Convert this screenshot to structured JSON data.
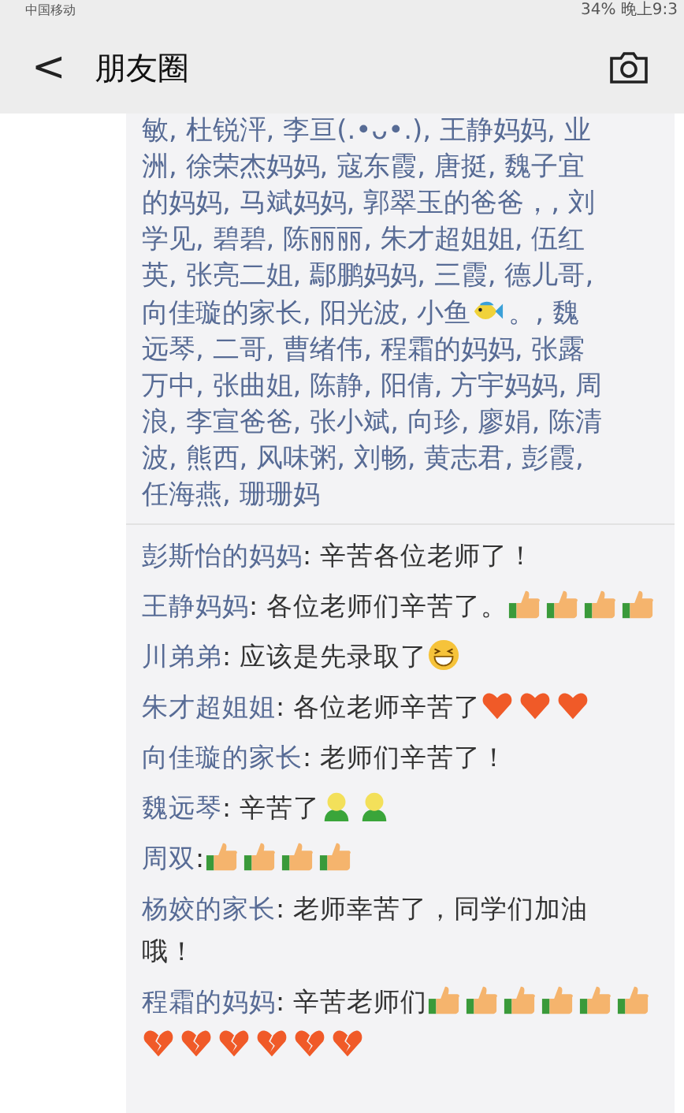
{
  "status_bar": {
    "carrier": "中国移动",
    "battery": "34%",
    "time": "晚上9:3"
  },
  "header": {
    "back": "<",
    "title": "朋友圈"
  },
  "likes": {
    "lines": [
      [
        {
          "kind": "text",
          "text": "敏, 杜锐泙, 李亘(.•ᴗ•.), 王静妈妈, 业"
        }
      ],
      [
        {
          "kind": "text",
          "text": "洲, 徐荣杰妈妈, 寇东霞, 唐挺, 魏子宜"
        }
      ],
      [
        {
          "kind": "text",
          "text": "的妈妈, 马斌妈妈, 郭翠玉的爸爸，, 刘"
        }
      ],
      [
        {
          "kind": "text",
          "text": "学见, 碧碧, 陈丽丽, 朱才超姐姐, 伍红"
        }
      ],
      [
        {
          "kind": "text",
          "text": "英, 张亮二姐, 鄢鹏妈妈, 三霞, 德儿哥,"
        }
      ],
      [
        {
          "kind": "text",
          "text": "向佳璇的家长, 阳光波, 小鱼"
        },
        {
          "kind": "fish"
        },
        {
          "kind": "text",
          "text": "。, 魏"
        }
      ],
      [
        {
          "kind": "text",
          "text": "远琴, 二哥, 曹绪伟, 程霜的妈妈, 张露"
        }
      ],
      [
        {
          "kind": "text",
          "text": "万中, 张曲姐, 陈静, 阳倩, 方宇妈妈, 周"
        }
      ],
      [
        {
          "kind": "text",
          "text": "浪, 李宣爸爸, 张小斌, 向珍, 廖娟, 陈清"
        }
      ],
      [
        {
          "kind": "text",
          "text": "波, 熊西, 风味粥, 刘畅, 黄志君, 彭霞,"
        }
      ],
      [
        {
          "kind": "text",
          "text": "任海燕, 珊珊妈"
        }
      ]
    ]
  },
  "comments": [
    {
      "name": "彭斯怡的妈妈",
      "text": ": 辛苦各位老师了！"
    },
    {
      "name": "王静妈妈",
      "text": ": 各位老师们辛苦了。",
      "emojis": [
        {
          "kind": "thumb"
        },
        {
          "kind": "thumb"
        },
        {
          "kind": "thumb"
        },
        {
          "kind": "thumb"
        }
      ]
    },
    {
      "name": "川弟弟",
      "text": ": 应该是先录取了",
      "emojis": [
        {
          "kind": "grin"
        }
      ]
    },
    {
      "name": "朱才超姐姐",
      "text": ": 各位老师辛苦了",
      "emojis": [
        {
          "kind": "heart"
        },
        {
          "kind": "heart"
        },
        {
          "kind": "heart"
        }
      ]
    },
    {
      "name": "向佳璇的家长",
      "text": ": 老师们辛苦了！"
    },
    {
      "name": "魏远琴",
      "text": ": 辛苦了",
      "emojis": [
        {
          "kind": "figure"
        },
        {
          "kind": "figure"
        }
      ]
    },
    {
      "name": "周双",
      "text": ":",
      "emojis": [
        {
          "kind": "thumb"
        },
        {
          "kind": "thumb"
        },
        {
          "kind": "thumb"
        },
        {
          "kind": "thumb"
        }
      ]
    },
    {
      "name": "杨姣的家长",
      "text": ": 老师幸苦了，同学们加油",
      "continuation": "哦！"
    },
    {
      "name": "程霜的妈妈",
      "text": ": 辛苦老师们",
      "emojis": [
        {
          "kind": "thumb"
        },
        {
          "kind": "thumb"
        },
        {
          "kind": "thumb"
        },
        {
          "kind": "thumb"
        },
        {
          "kind": "thumb"
        },
        {
          "kind": "thumb"
        },
        {
          "kind": "broken_heart"
        },
        {
          "kind": "broken_heart"
        },
        {
          "kind": "broken_heart"
        },
        {
          "kind": "broken_heart"
        },
        {
          "kind": "broken_heart"
        },
        {
          "kind": "broken_heart"
        }
      ]
    }
  ]
}
